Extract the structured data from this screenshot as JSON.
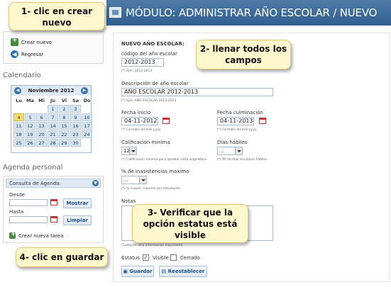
{
  "header": {
    "title": "MÓDULO: ADMINISTRAR AÑO ESCOLAR / NUEVO"
  },
  "left_nav": {
    "items": [
      {
        "label": "Crear nuevo"
      },
      {
        "label": "Regresar"
      }
    ]
  },
  "calendar": {
    "section_title": "Calendario",
    "month": "Noviembre 2012",
    "weekdays": [
      "Lu",
      "Ma",
      "Mi",
      "Ju",
      "Vi",
      "Sa",
      "Do"
    ],
    "days": [
      "",
      "",
      "",
      "1",
      "2",
      "3",
      "",
      "4",
      "5",
      "6",
      "7",
      "8",
      "9",
      "10",
      "11",
      "12",
      "13",
      "14",
      "15",
      "16",
      "17",
      "18",
      "19",
      "20",
      "21",
      "22",
      "23",
      "24",
      "25",
      "26",
      "27",
      "28",
      "29",
      "30",
      ""
    ],
    "today": "4"
  },
  "agenda": {
    "section_title": "Agenda personal",
    "header": "Consulta de Agenda:",
    "desde_label": "Desde",
    "hasta_label": "Hasta",
    "mostrar_button": "Mostrar",
    "limpiar_button": "Limpiar",
    "new_task_link": "Crear nueva tarea"
  },
  "form": {
    "section_title": "NUEVO AÑO ESCOLAR:",
    "codigo_label": "código del año escolar",
    "codigo_value": "2012-2013",
    "codigo_hint": "(*) Ejm: 2012-2013",
    "descripcion_label": "Descripción de año escolar",
    "descripcion_value": "AÑO ESCOLAR 2012-2013",
    "descripcion_hint": "(*) Ejm: AÑO ESCOLAR 2012-2013",
    "fecha_inicio_label": "Fecha inicio",
    "fecha_inicio_value": "04-11-2012",
    "fecha_inicio_hint": "(*) Formato dd-mm-yyyy",
    "fecha_culm_label": "Fecha culminación",
    "fecha_culm_value": "04-11-2013",
    "fecha_culm_hint": "(*) Formato dd-mm-yyyy",
    "calificacion_label": "Calificación minima",
    "calificacion_value": "12",
    "calificacion_hint": "(*) Calificación minima para aprobar cada asignatura",
    "dias_label": "Días hábiles",
    "dias_value": "...",
    "dias_hint": "(*) Nº de días escolares hábiles",
    "inasistencia_label": "% de inasistencias maximo",
    "inasistencia_value": "...",
    "inasistencia_hint": "(*) % inasist. maximo por estudiante",
    "notas_label": "Notas",
    "notas_hint": "Cualquier otra información importante",
    "estatus_label": "Estatus",
    "visible_label": "Visible",
    "cerrado_label": "Cerrado",
    "guardar_button": "Guardar",
    "reestablecer_button": "Reestablecer"
  },
  "callouts": {
    "c1_line1": "1- clic en crear",
    "c1_line2": "nuevo",
    "c2_line1": "2- llenar todos los",
    "c2_line2": "campos",
    "c3_line1": "3- Verificar que la",
    "c3_line2": "opción estatus está",
    "c3_line3": "visible",
    "c4": "4- clic en guardar"
  }
}
